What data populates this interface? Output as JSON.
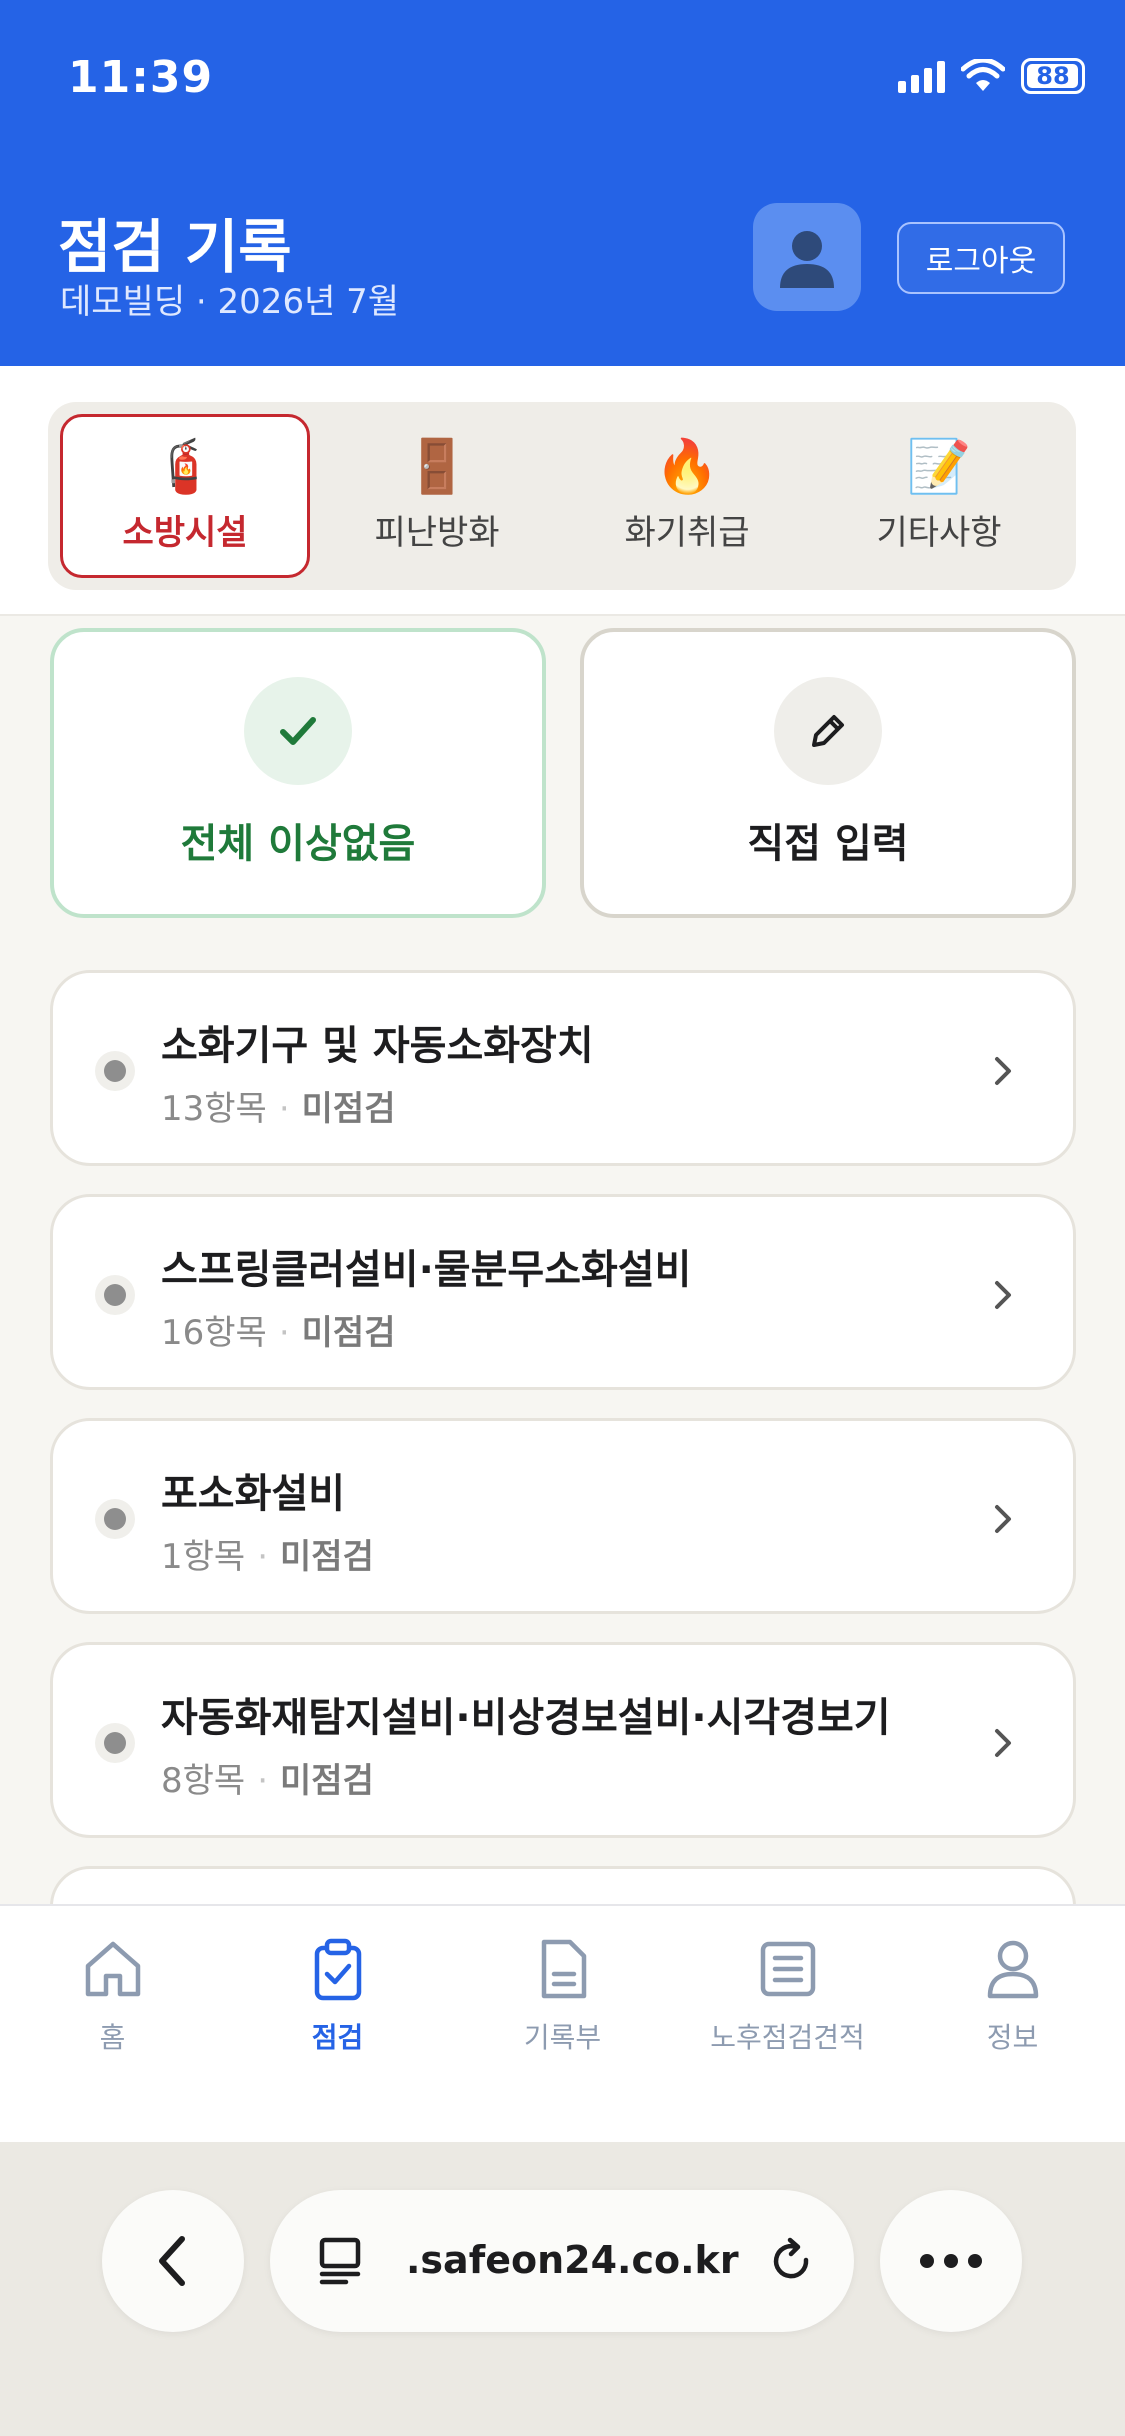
{
  "status_bar": {
    "time": "11:39",
    "battery": "88"
  },
  "header": {
    "title": "점검 기록",
    "subtitle": "데모빌딩 · 2026년 7월",
    "logout_label": "로그아웃"
  },
  "categories": [
    {
      "icon": "fire-extinguisher-icon",
      "emoji": "🧯",
      "label": "소방시설",
      "active": true
    },
    {
      "icon": "door-icon",
      "emoji": "🚪",
      "label": "피난방화",
      "active": false
    },
    {
      "icon": "fire-icon",
      "emoji": "🔥",
      "label": "화기취급",
      "active": false
    },
    {
      "icon": "memo-icon",
      "emoji": "📝",
      "label": "기타사항",
      "active": false
    }
  ],
  "actions": {
    "all_ok_label": "전체 이상없음",
    "manual_label": "직접 입력"
  },
  "items": [
    {
      "title": "소화기구 및 자동소화장치",
      "count": "13항목",
      "status": "미점검"
    },
    {
      "title": "스프링클러설비·물분무소화설비",
      "count": "16항목",
      "status": "미점검"
    },
    {
      "title": "포소화설비",
      "count": "1항목",
      "status": "미점검"
    },
    {
      "title": "자동화재탐지설비·비상경보설비·시각경보기",
      "count": "8항목",
      "status": "미점검"
    }
  ],
  "nav": [
    {
      "icon": "home-icon",
      "label": "홈",
      "active": false
    },
    {
      "icon": "clipboard-check-icon",
      "label": "점검",
      "active": true
    },
    {
      "icon": "document-icon",
      "label": "기록부",
      "active": false
    },
    {
      "icon": "list-doc-icon",
      "label": "노후점검견적",
      "active": false
    },
    {
      "icon": "person-icon",
      "label": "정보",
      "active": false
    }
  ],
  "browser": {
    "url": ".safeon24.co.kr"
  },
  "colors": {
    "brand": "#2563e6",
    "active_tab": "#c5282f",
    "ok_green": "#1f7a3a"
  }
}
